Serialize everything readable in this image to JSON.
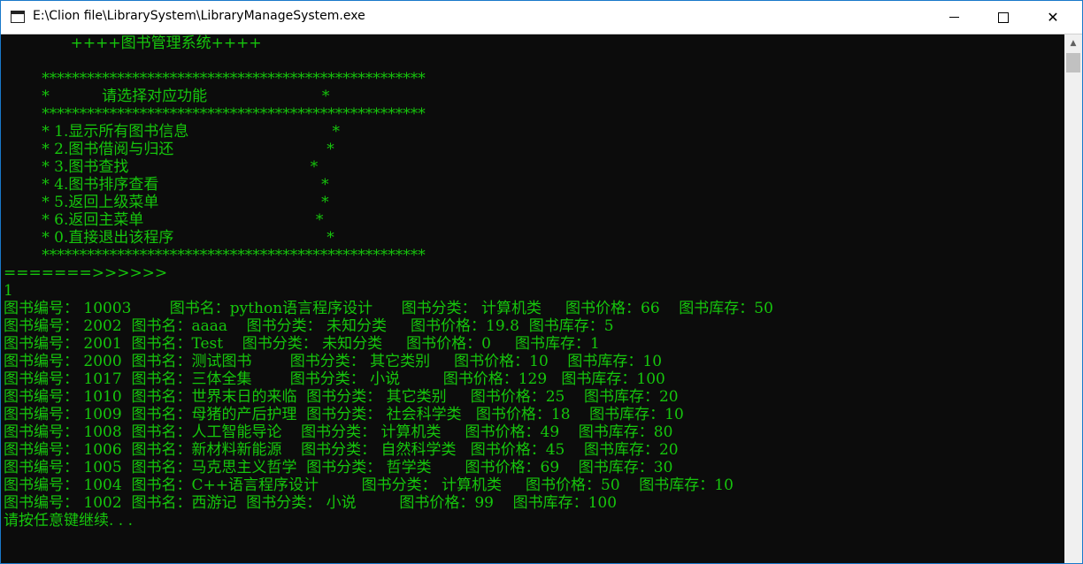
{
  "window": {
    "title": "E:\\Clion file\\LibrarySystem\\LibraryManageSystem.exe",
    "close_glyph": "✕"
  },
  "console": {
    "lines": [
      "              ++++图书管理系统++++",
      "",
      "        ***************************************************",
      "        *           请选择对应功能                        *",
      "        ***************************************************",
      "        * 1.显示所有图书信息                              *",
      "        * 2.图书借阅与归还                                *",
      "        * 3.图书查找                                      *",
      "        * 4.图书排序查看                                  *",
      "        * 5.返回上级菜单                                  *",
      "        * 6.返回主菜单                                    *",
      "        * 0.直接退出该程序                                *",
      "        ***************************************************",
      "=======>>>>>>",
      "1",
      "图书编号： 10003        图书名：python语言程序设计      图书分类： 计算机类     图书价格：66    图书库存：50",
      "图书编号： 2002  图书名：aaaa    图书分类： 未知分类     图书价格：19.8  图书库存：5",
      "图书编号： 2001  图书名：Test    图书分类： 未知分类     图书价格：0     图书库存：1",
      "图书编号： 2000  图书名：测试图书        图书分类： 其它类别     图书价格：10    图书库存：10",
      "图书编号： 1017  图书名：三体全集        图书分类： 小说         图书价格：129   图书库存：100",
      "图书编号： 1010  图书名：世界末日的来临  图书分类： 其它类别     图书价格：25    图书库存：20",
      "图书编号： 1009  图书名：母猪的产后护理  图书分类： 社会科学类   图书价格：18    图书库存：10",
      "图书编号： 1008  图书名：人工智能导论    图书分类： 计算机类     图书价格：49    图书库存：80",
      "图书编号： 1006  图书名：新材料新能源    图书分类： 自然科学类   图书价格：45    图书库存：20",
      "图书编号： 1005  图书名：马克思主义哲学  图书分类： 哲学类       图书价格：69    图书库存：30",
      "图书编号： 1004  图书名：C++语言程序设计         图书分类： 计算机类     图书价格：50    图书库存：10",
      "图书编号： 1002  图书名：西游记  图书分类： 小说         图书价格：99    图书库存：100",
      "请按任意键继续. . ."
    ]
  },
  "scrollbar": {
    "up_arrow": "▲"
  }
}
